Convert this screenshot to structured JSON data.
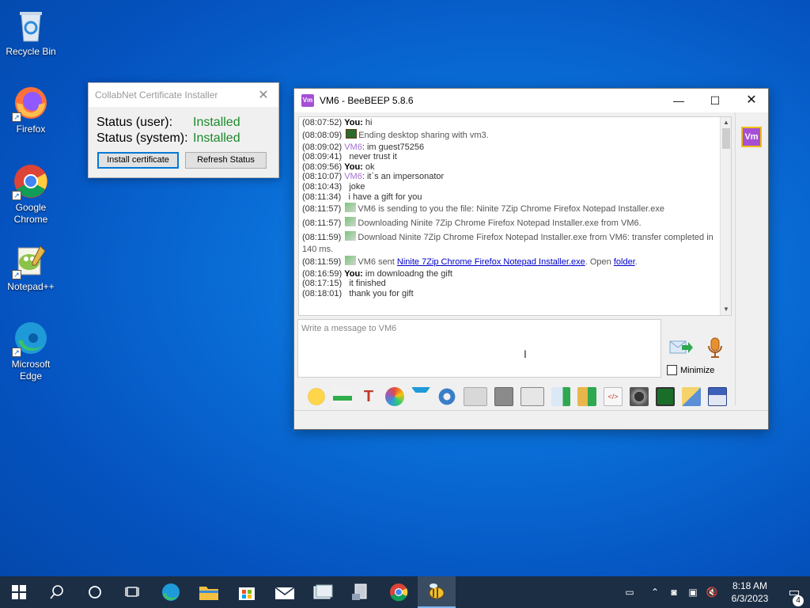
{
  "desktop": {
    "icons": [
      {
        "label": "Recycle Bin"
      },
      {
        "label": "Firefox"
      },
      {
        "label": "Google Chrome"
      },
      {
        "label": "Notepad++"
      },
      {
        "label": "Microsoft Edge"
      }
    ]
  },
  "cert_window": {
    "title": "CollabNet Certificate Installer",
    "status_user_label": "Status (user):",
    "status_user_value": "Installed",
    "status_system_label": "Status (system):",
    "status_system_value": "Installed",
    "install_button": "Install certificate",
    "refresh_button": "Refresh Status",
    "status_color": "#1b8a2a"
  },
  "bee_window": {
    "title": "VM6 - BeeBEEP 5.8.6",
    "side_badge": "Vm",
    "input_placeholder": "Write a message to VM6",
    "minimize_label": "Minimize",
    "chat": {
      "l01_ts": "(08:07:52)",
      "l01_who": "You:",
      "l01_msg": " hi",
      "l02_ts": "(08:08:09)",
      "l02_msg": "Ending desktop sharing with vm3.",
      "l03_ts": "(08:09:02)",
      "l03_who": "VM6",
      "l03_msg": ": im guest75256",
      "l04_ts": "(08:09:41)",
      "l04_msg": "never trust it",
      "l05_ts": "(08:09:56)",
      "l05_who": "You:",
      "l05_msg": " ok",
      "l06_ts": "(08:10:07)",
      "l06_who": "VM6",
      "l06_msg": ": it`s an impersonator",
      "l07_ts": "(08:10:43)",
      "l07_msg": "joke",
      "l08_ts": "(08:11:34)",
      "l08_msg": "i have a gift for you",
      "l09_ts": "(08:11:57)",
      "l09_msg": "VM6 is sending to you the file: Ninite 7Zip Chrome Firefox Notepad Installer.exe",
      "l10_ts": "(08:11:57)",
      "l10_msg": "Downloading Ninite 7Zip Chrome Firefox Notepad Installer.exe from VM6.",
      "l11_ts": "(08:11:59)",
      "l11_msg": "Download Ninite 7Zip Chrome Firefox Notepad Installer.exe from VM6: transfer completed in",
      "l11_cont": "140 ms.",
      "l12_ts": "(08:11:59)",
      "l12_pre": "VM6 sent ",
      "l12_link": "Ninite 7Zip Chrome Firefox Notepad Installer.exe",
      "l12_mid": ". Open ",
      "l12_folder": "folder",
      "l12_end": ".",
      "l13_ts": "(08:16:59)",
      "l13_who": "You:",
      "l13_msg": " im downloadng the gift",
      "l14_ts": "(08:17:15)",
      "l14_msg": "it finished",
      "l15_ts": "(08:18:01)",
      "l15_msg": "thank you for gift"
    },
    "toolbar_icons": [
      "smiley-icon",
      "highlight-icon",
      "font-icon",
      "color-palette-icon",
      "filter-icon",
      "settings-icon",
      "print-icon",
      "spellcheck-icon",
      "note-icon",
      "send-file-icon",
      "folder-export-icon",
      "html-icon",
      "screenshot-icon",
      "screen-share-icon",
      "edit-icon",
      "save-icon"
    ]
  },
  "taskbar": {
    "clock_time": "8:18 AM",
    "clock_date": "6/3/2023",
    "notification_count": "4"
  }
}
